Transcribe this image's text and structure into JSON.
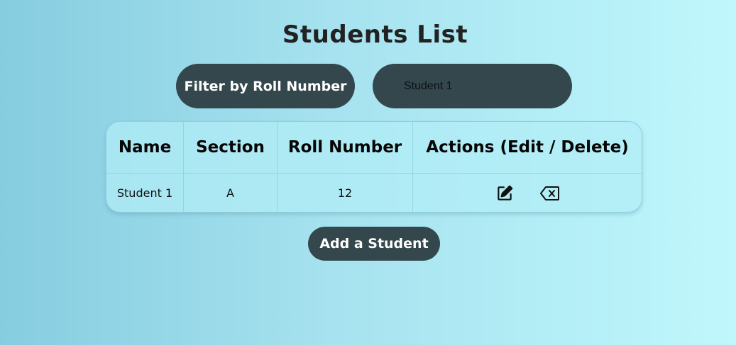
{
  "page": {
    "title": "Students List"
  },
  "filter": {
    "button_label": "Filter by Roll Number",
    "input_value": "Student 1",
    "input_placeholder": "Student 1"
  },
  "table": {
    "headers": {
      "name": "Name",
      "section": "Section",
      "roll_number": "Roll Number",
      "actions": "Actions (Edit / Delete)"
    },
    "rows": [
      {
        "name": "Student 1",
        "section": "A",
        "roll_number": "12",
        "edit_icon": "edit-icon",
        "delete_icon": "backspace-delete-icon"
      }
    ]
  },
  "actions": {
    "add_label": "Add a Student"
  },
  "colors": {
    "button_bg": "#34474c",
    "gradient_start": "#86cde0",
    "gradient_end": "#bff7fc",
    "table_bg": "#b2eef6"
  }
}
